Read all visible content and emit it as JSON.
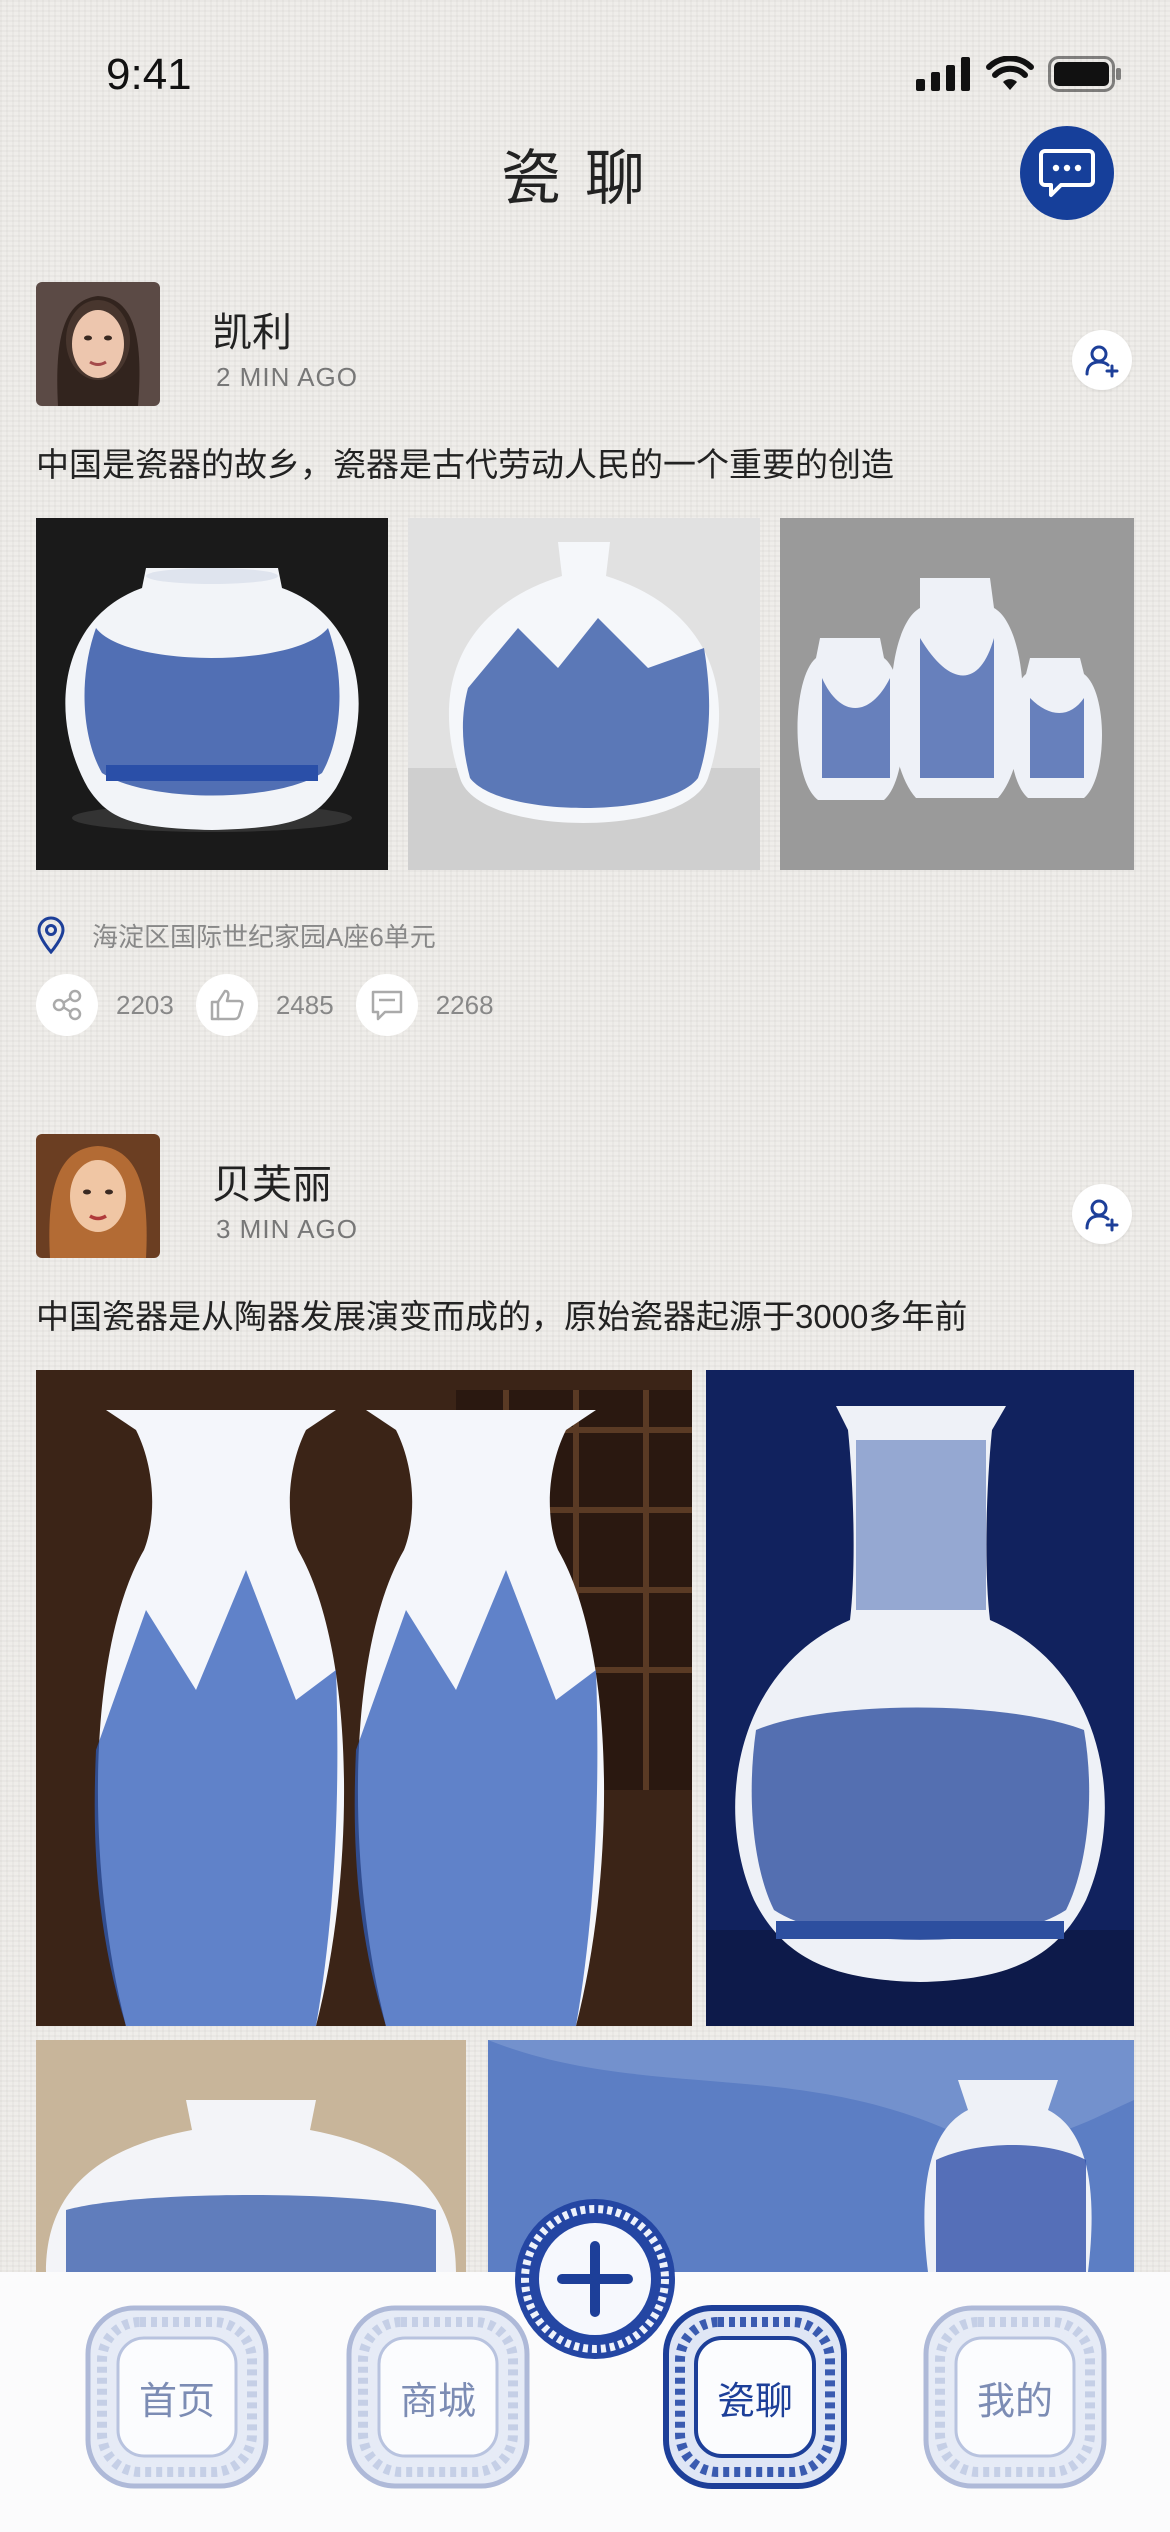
{
  "status_bar": {
    "time": "9:41"
  },
  "header": {
    "title": "瓷聊"
  },
  "posts": [
    {
      "name": "凯利",
      "time_ago": "2 MIN AGO",
      "text": "中国是瓷器的故乡，瓷器是古代劳动人民的一个重要的创造",
      "location": "海淀区国际世纪家园A座6单元",
      "shares": "2203",
      "likes": "2485",
      "comments": "2268"
    },
    {
      "name": "贝芙丽",
      "time_ago": "3 MIN AGO",
      "text": "中国瓷器是从陶器发展演变而成的，原始瓷器起源于3000多年前"
    }
  ],
  "tabs": [
    {
      "label": "首页"
    },
    {
      "label": "商城"
    },
    {
      "label": "瓷聊",
      "active": true
    },
    {
      "label": "我的"
    }
  ],
  "colors": {
    "brand_blue": "#163f9a",
    "porcelain_blue": "#2a4fa8",
    "tab_inactive": "#7c8cb4"
  }
}
